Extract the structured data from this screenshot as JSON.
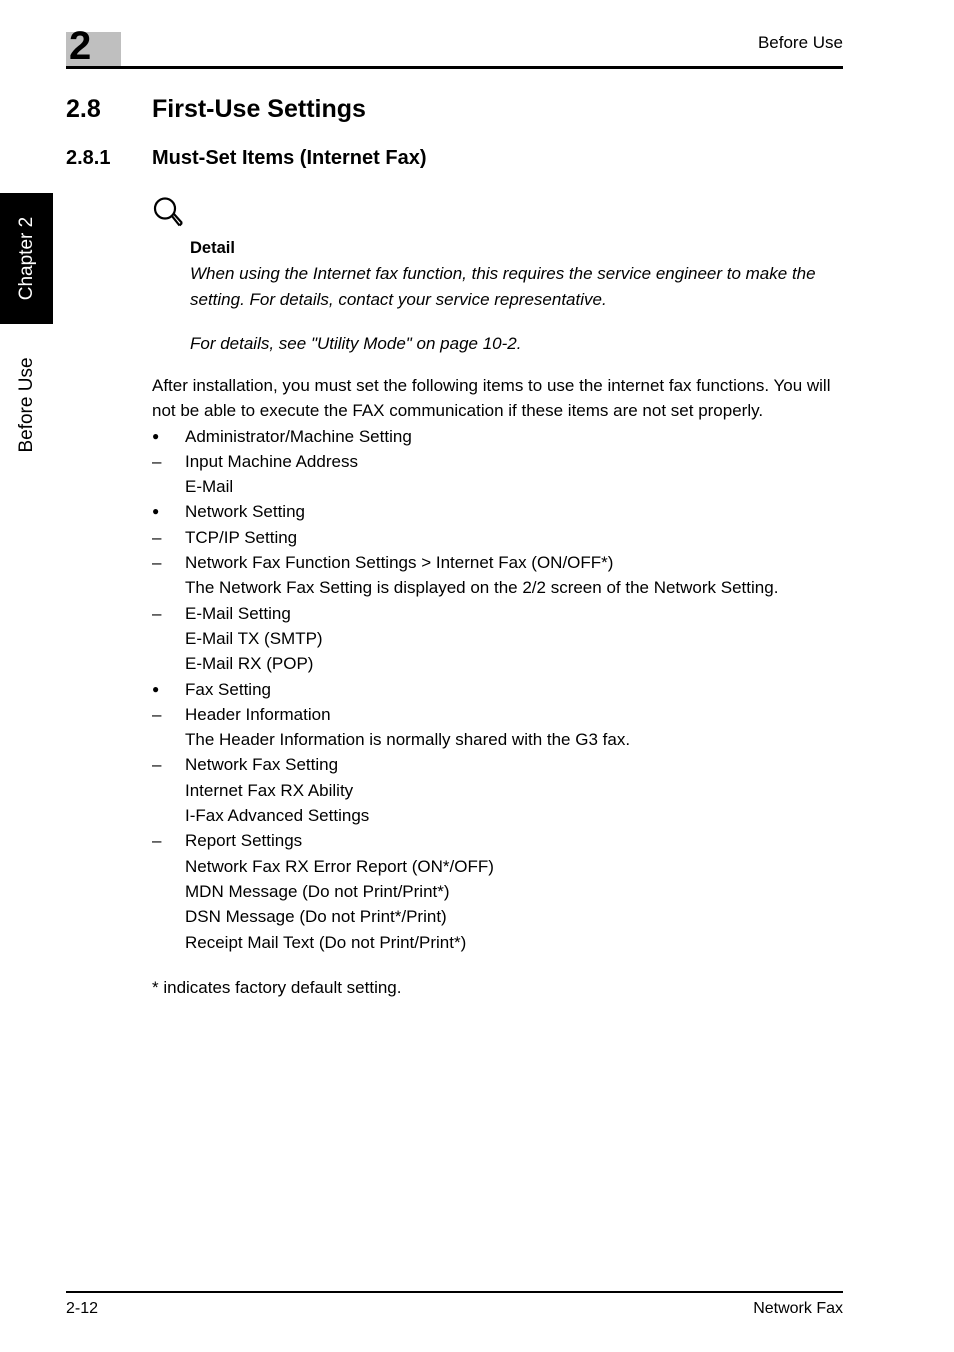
{
  "header": {
    "chapter_number": "2",
    "running_title": "Before Use"
  },
  "side_tabs": {
    "chapter_tab": "Chapter 2",
    "section_tab": "Before Use"
  },
  "headings": {
    "h1_number": "2.8",
    "h1_title": "First-Use Settings",
    "h2_number": "2.8.1",
    "h2_title": "Must-Set Items (Internet Fax)"
  },
  "callout": {
    "icon": "magnifier-icon",
    "heading": "Detail",
    "paragraph": "When using the Internet fax function, this requires the service engineer to make the setting. For details, contact your service representative.",
    "reference": "For details, see \"Utility Mode\" on page 10-2."
  },
  "body": {
    "intro": "After installation, you must set the following items to use the internet fax functions. You will not be able to execute the FAX communication if these items are not set properly.",
    "items": [
      {
        "marker": "●",
        "marker_type": "bullet",
        "text": "Administrator/Machine Setting",
        "sub": []
      },
      {
        "marker": "–",
        "marker_type": "dash",
        "text": "Input Machine Address",
        "sub": [
          "E-Mail"
        ]
      },
      {
        "marker": "●",
        "marker_type": "bullet",
        "text": "Network Setting",
        "sub": []
      },
      {
        "marker": "–",
        "marker_type": "dash",
        "text": "TCP/IP Setting",
        "sub": []
      },
      {
        "marker": "–",
        "marker_type": "dash",
        "text": "Network Fax Function Settings > Internet Fax (ON/OFF*)",
        "sub": [
          "The Network Fax Setting is displayed on the 2/2 screen of the Network Setting."
        ]
      },
      {
        "marker": "–",
        "marker_type": "dash",
        "text": "E-Mail Setting",
        "sub": [
          "E-Mail TX (SMTP)",
          "E-Mail RX (POP)"
        ]
      },
      {
        "marker": "●",
        "marker_type": "bullet",
        "text": "Fax Setting",
        "sub": []
      },
      {
        "marker": "–",
        "marker_type": "dash",
        "text": "Header Information",
        "sub": [
          "The Header Information is normally shared with the G3 fax."
        ]
      },
      {
        "marker": "–",
        "marker_type": "dash",
        "text": "Network Fax Setting",
        "sub": [
          "Internet Fax RX Ability",
          "I-Fax Advanced Settings"
        ]
      },
      {
        "marker": "–",
        "marker_type": "dash",
        "text": "Report Settings",
        "sub": [
          "Network Fax RX Error Report (ON*/OFF)",
          "MDN Message (Do not Print/Print*)",
          "DSN Message (Do not Print*/Print)",
          "Receipt Mail Text (Do not Print/Print*)"
        ]
      }
    ],
    "footnote": "* indicates factory default setting."
  },
  "footer": {
    "page_number": "2-12",
    "document_title": "Network Fax"
  },
  "colors": {
    "text": "#000000",
    "badge_box": "#bfbfbf",
    "tab_active": "#000000",
    "page_background": "#ffffff"
  }
}
